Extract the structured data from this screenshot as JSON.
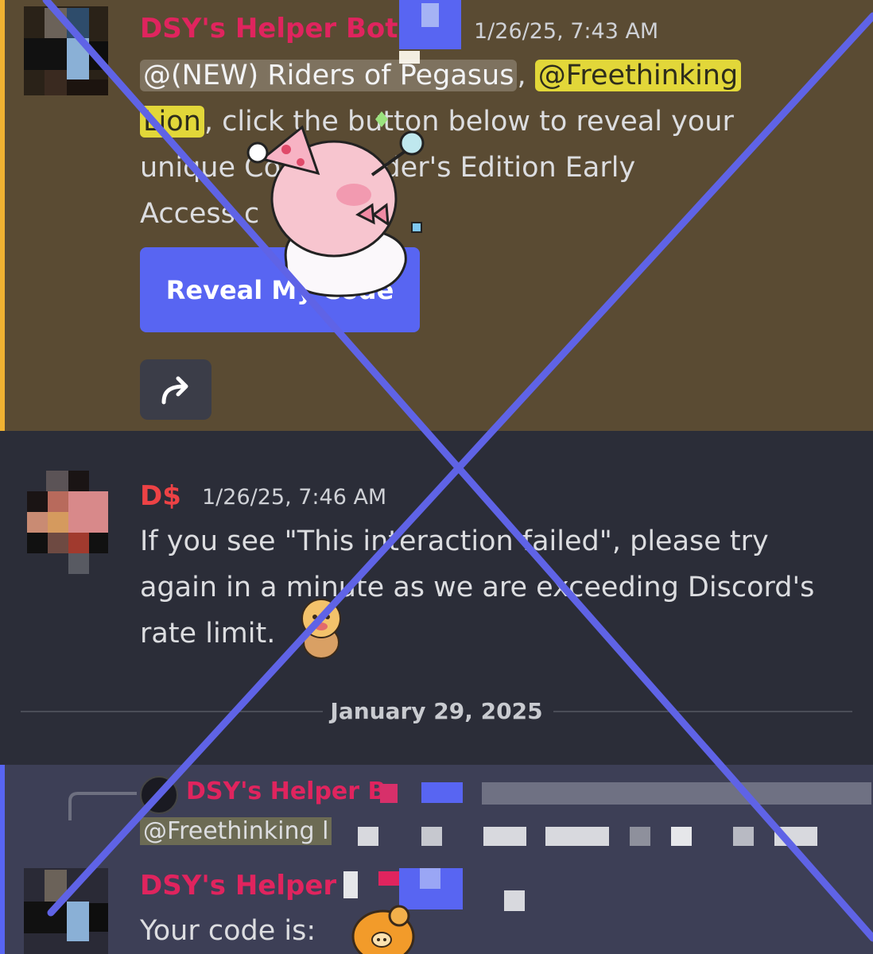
{
  "message1": {
    "username": "DSY's Helper Bot",
    "timestamp": "1/26/25, 7:43 AM",
    "mention_role": "@(NEW) Riders of Pegasus",
    "separator": ",",
    "mention_user_part1": "@Freethinking",
    "mention_user_part2": "Lion",
    "line1_rest": ", click the button below to reveal your",
    "line2": "unique Co      e Founder's Edition Early",
    "line3": "Access c",
    "button_label": "Reveal My Code",
    "share_icon": "share-arrow-icon"
  },
  "message2": {
    "username": "D$",
    "timestamp": "1/26/25, 7:46 AM",
    "line1": "If you see \"This interaction failed\", please try",
    "line2": "again in a minute as we are exceeding Discord's",
    "line3": "rate limit."
  },
  "date_divider": "January 29, 2025",
  "reply_preview": {
    "username": "DSY's Helper B",
    "mention": "@Freethinking l"
  },
  "message3": {
    "username": "DSY's Helper",
    "text": "Your code is:"
  },
  "colors": {
    "bot_name": "#e0245e",
    "dollar_name": "#ed4245",
    "blurple": "#5865f2",
    "mention_highlight": "#f1e73a",
    "cross_stroke": "#5f63e6"
  }
}
